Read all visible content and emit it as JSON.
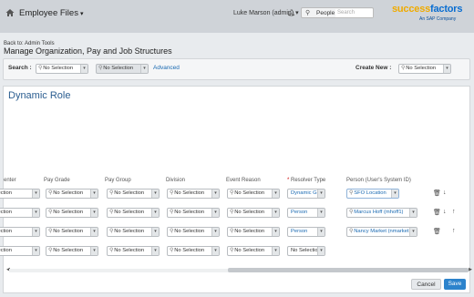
{
  "header": {
    "app_name": "Employee Files",
    "user": "Luke Marson (admin)",
    "search_label": "People",
    "search_placeholder": "Search",
    "logo_main": "success",
    "logo_accent": "factors",
    "logo_tagline": "An SAP Company"
  },
  "breadcrumb": "Back to: Admin Tools",
  "page_title": "Manage Organization, Pay and Job Structures",
  "searchbar": {
    "search_label": "Search :",
    "select1": "No Selection",
    "select2": "No Selection",
    "advanced": "Advanced",
    "create_label": "Create New :",
    "create_select": "No Selection"
  },
  "panel": {
    "title": "Dynamic Role"
  },
  "columns": {
    "center": "enter",
    "pay_grade": "Pay Grade",
    "pay_group": "Pay Group",
    "division": "Division",
    "event_reason": "Event Reason",
    "resolver_type": "Resolver Type",
    "person": "Person (User's System ID)"
  },
  "rows": [
    {
      "c0": "election",
      "c1": "No Selection",
      "c2": "No Selection",
      "c3": "No Selection",
      "c4": "No Selection",
      "resolver": "Dynamic Group",
      "person": "SFO Location"
    },
    {
      "c0": "election",
      "c1": "No Selection",
      "c2": "No Selection",
      "c3": "No Selection",
      "c4": "No Selection",
      "resolver": "Person",
      "person": "Marcus Hoff (mhoff1)"
    },
    {
      "c0": "election",
      "c1": "No Selection",
      "c2": "No Selection",
      "c3": "No Selection",
      "c4": "No Selection",
      "resolver": "Person",
      "person": "Nancy Market (nmarket1)"
    },
    {
      "c0": "election",
      "c1": "No Selection",
      "c2": "No Selection",
      "c3": "No Selection",
      "c4": "No Selection",
      "resolver": "No Selection",
      "person": ""
    }
  ],
  "buttons": {
    "cancel": "Cancel",
    "save": "Save"
  }
}
